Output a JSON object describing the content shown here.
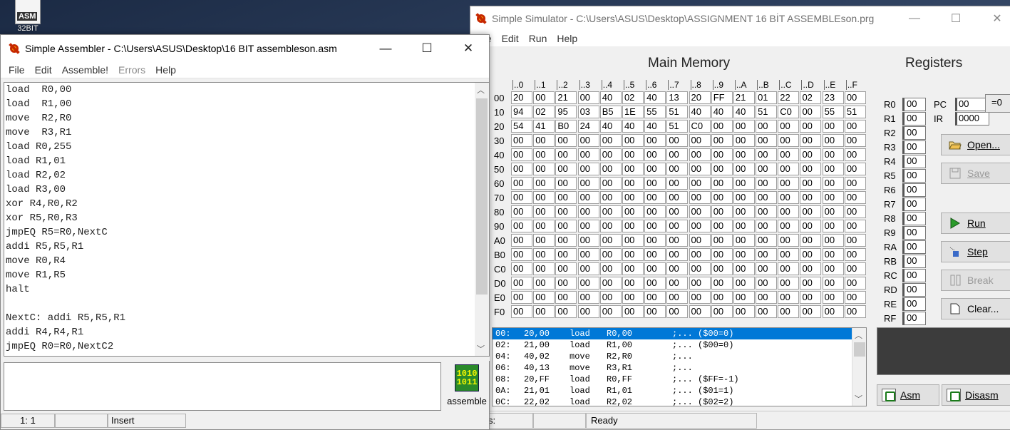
{
  "desktop": {
    "icon_label": "ASM",
    "icon_caption": "32BIT"
  },
  "simulator": {
    "title": "Simple Simulator - C:\\Users\\ASUS\\Desktop\\ASSIGNMENT 16 BİT ASSEMBLEson.prg",
    "menu": [
      "File",
      "Edit",
      "Run",
      "Help"
    ],
    "main_memory_title": "Main Memory",
    "registers_title": "Registers",
    "col_headers": [
      "..0",
      "..1",
      "..2",
      "..3",
      "..4",
      "..5",
      "..6",
      "..7",
      "..8",
      "..9",
      "..A",
      "..B",
      "..C",
      "..D",
      "..E",
      "..F"
    ],
    "memory_rows": [
      {
        "label": "00",
        "cells": [
          "20",
          "00",
          "21",
          "00",
          "40",
          "02",
          "40",
          "13",
          "20",
          "FF",
          "21",
          "01",
          "22",
          "02",
          "23",
          "00"
        ]
      },
      {
        "label": "10",
        "cells": [
          "94",
          "02",
          "95",
          "03",
          "B5",
          "1E",
          "55",
          "51",
          "40",
          "40",
          "40",
          "51",
          "C0",
          "00",
          "55",
          "51"
        ]
      },
      {
        "label": "20",
        "cells": [
          "54",
          "41",
          "B0",
          "24",
          "40",
          "40",
          "40",
          "51",
          "C0",
          "00",
          "00",
          "00",
          "00",
          "00",
          "00",
          "00"
        ]
      },
      {
        "label": "30",
        "cells": [
          "00",
          "00",
          "00",
          "00",
          "00",
          "00",
          "00",
          "00",
          "00",
          "00",
          "00",
          "00",
          "00",
          "00",
          "00",
          "00"
        ]
      },
      {
        "label": "40",
        "cells": [
          "00",
          "00",
          "00",
          "00",
          "00",
          "00",
          "00",
          "00",
          "00",
          "00",
          "00",
          "00",
          "00",
          "00",
          "00",
          "00"
        ]
      },
      {
        "label": "50",
        "cells": [
          "00",
          "00",
          "00",
          "00",
          "00",
          "00",
          "00",
          "00",
          "00",
          "00",
          "00",
          "00",
          "00",
          "00",
          "00",
          "00"
        ]
      },
      {
        "label": "60",
        "cells": [
          "00",
          "00",
          "00",
          "00",
          "00",
          "00",
          "00",
          "00",
          "00",
          "00",
          "00",
          "00",
          "00",
          "00",
          "00",
          "00"
        ]
      },
      {
        "label": "70",
        "cells": [
          "00",
          "00",
          "00",
          "00",
          "00",
          "00",
          "00",
          "00",
          "00",
          "00",
          "00",
          "00",
          "00",
          "00",
          "00",
          "00"
        ]
      },
      {
        "label": "80",
        "cells": [
          "00",
          "00",
          "00",
          "00",
          "00",
          "00",
          "00",
          "00",
          "00",
          "00",
          "00",
          "00",
          "00",
          "00",
          "00",
          "00"
        ]
      },
      {
        "label": "90",
        "cells": [
          "00",
          "00",
          "00",
          "00",
          "00",
          "00",
          "00",
          "00",
          "00",
          "00",
          "00",
          "00",
          "00",
          "00",
          "00",
          "00"
        ]
      },
      {
        "label": "A0",
        "cells": [
          "00",
          "00",
          "00",
          "00",
          "00",
          "00",
          "00",
          "00",
          "00",
          "00",
          "00",
          "00",
          "00",
          "00",
          "00",
          "00"
        ]
      },
      {
        "label": "B0",
        "cells": [
          "00",
          "00",
          "00",
          "00",
          "00",
          "00",
          "00",
          "00",
          "00",
          "00",
          "00",
          "00",
          "00",
          "00",
          "00",
          "00"
        ]
      },
      {
        "label": "C0",
        "cells": [
          "00",
          "00",
          "00",
          "00",
          "00",
          "00",
          "00",
          "00",
          "00",
          "00",
          "00",
          "00",
          "00",
          "00",
          "00",
          "00"
        ]
      },
      {
        "label": "D0",
        "cells": [
          "00",
          "00",
          "00",
          "00",
          "00",
          "00",
          "00",
          "00",
          "00",
          "00",
          "00",
          "00",
          "00",
          "00",
          "00",
          "00"
        ]
      },
      {
        "label": "E0",
        "cells": [
          "00",
          "00",
          "00",
          "00",
          "00",
          "00",
          "00",
          "00",
          "00",
          "00",
          "00",
          "00",
          "00",
          "00",
          "00",
          "00"
        ]
      },
      {
        "label": "F0",
        "cells": [
          "00",
          "00",
          "00",
          "00",
          "00",
          "00",
          "00",
          "00",
          "00",
          "00",
          "00",
          "00",
          "00",
          "00",
          "00",
          "00"
        ]
      }
    ],
    "registers": [
      {
        "name": "R0",
        "value": "00"
      },
      {
        "name": "R1",
        "value": "00"
      },
      {
        "name": "R2",
        "value": "00"
      },
      {
        "name": "R3",
        "value": "00"
      },
      {
        "name": "R4",
        "value": "00"
      },
      {
        "name": "R5",
        "value": "00"
      },
      {
        "name": "R6",
        "value": "00"
      },
      {
        "name": "R7",
        "value": "00"
      },
      {
        "name": "R8",
        "value": "00"
      },
      {
        "name": "R9",
        "value": "00"
      },
      {
        "name": "RA",
        "value": "00"
      },
      {
        "name": "RB",
        "value": "00"
      },
      {
        "name": "RC",
        "value": "00"
      },
      {
        "name": "RD",
        "value": "00"
      },
      {
        "name": "RE",
        "value": "00"
      },
      {
        "name": "RF",
        "value": "00"
      }
    ],
    "pc": {
      "label": "PC",
      "value": "00"
    },
    "ir": {
      "label": "IR",
      "value": "0000"
    },
    "eq_zero_label": "=0",
    "buttons": {
      "open": "Open...",
      "save": "Save",
      "run": "Run",
      "step": "Step",
      "break": "Break",
      "clear": "Clear...",
      "asm": "Asm",
      "disasm": "Disasm"
    },
    "disassembly": [
      {
        "addr": "00:",
        "bytes": "20,00",
        "mnemonic": "load",
        "operands": "R0,00",
        "comment": ";... ($00=0)"
      },
      {
        "addr": "02:",
        "bytes": "21,00",
        "mnemonic": "load",
        "operands": "R1,00",
        "comment": ";... ($00=0)"
      },
      {
        "addr": "04:",
        "bytes": "40,02",
        "mnemonic": "move",
        "operands": "R2,R0",
        "comment": ";..."
      },
      {
        "addr": "06:",
        "bytes": "40,13",
        "mnemonic": "move",
        "operands": "R3,R1",
        "comment": ";..."
      },
      {
        "addr": "08:",
        "bytes": "20,FF",
        "mnemonic": "load",
        "operands": "R0,FF",
        "comment": ";... ($FF=-1)"
      },
      {
        "addr": "0A:",
        "bytes": "21,01",
        "mnemonic": "load",
        "operands": "R1,01",
        "comment": ";... ($01=1)"
      },
      {
        "addr": "0C:",
        "bytes": "22,02",
        "mnemonic": "load",
        "operands": "R2,02",
        "comment": ";... ($02=2)"
      }
    ],
    "status": {
      "left": "ress:",
      "right": "Ready"
    }
  },
  "assembler": {
    "title": "Simple Assembler - C:\\Users\\ASUS\\Desktop\\16 BIT assembleson.asm",
    "menu": [
      {
        "label": "File",
        "enabled": true
      },
      {
        "label": "Edit",
        "enabled": true
      },
      {
        "label": "Assemble!",
        "enabled": true
      },
      {
        "label": "Errors",
        "enabled": false
      },
      {
        "label": "Help",
        "enabled": true
      }
    ],
    "code_lines": [
      "load  R0,00",
      "load  R1,00",
      "move  R2,R0",
      "move  R3,R1",
      "load R0,255",
      "load R1,01",
      "load R2,02",
      "load R3,00",
      "xor R4,R0,R2",
      "xor R5,R0,R3",
      "jmpEQ R5=R0,NextC",
      "addi R5,R5,R1",
      "move R0,R4",
      "move R1,R5",
      "halt",
      "",
      "NextC: addi R5,R5,R1",
      "addi R4,R4,R1",
      "jmpEQ R0=R0,NextC2"
    ],
    "assemble_label": "assemble",
    "status": {
      "position": "1: 1",
      "mode": "Insert"
    }
  }
}
